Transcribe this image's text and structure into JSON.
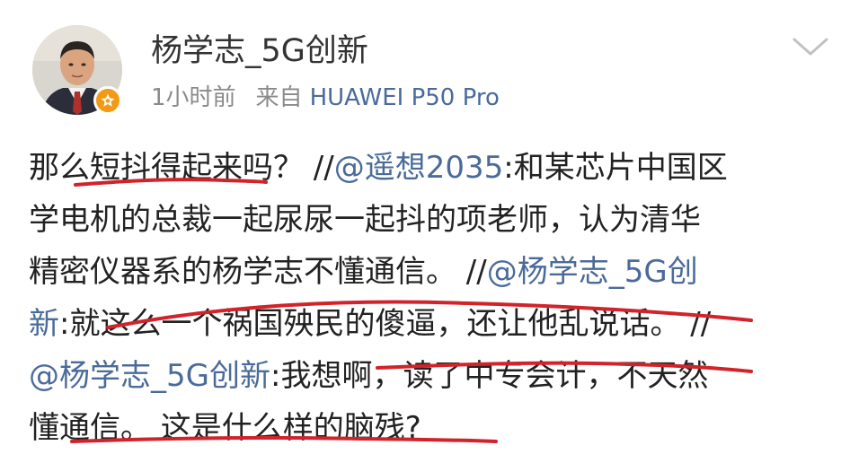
{
  "post": {
    "username": "杨学志_5G创新",
    "time": "1小时前",
    "source_prefix": "来自",
    "device": "HUAWEI P50 Pro",
    "avatar": "avatar-photo",
    "verified_badge": "star-badge-icon",
    "menu_icon": "chevron-down-icon",
    "body_lines": [
      [
        {
          "text": "那么短抖得起来吗？ //"
        },
        {
          "text": "@遥想2035",
          "mention": true
        },
        {
          "text": ":和某芯片中国区"
        }
      ],
      [
        {
          "text": "学电机的总裁一起尿尿一起抖的项老师，认为清华"
        }
      ],
      [
        {
          "text": "精密仪器系的杨学志不懂通信。 //"
        },
        {
          "text": "@杨学志_5G创",
          "mention": true
        }
      ],
      [
        {
          "text": "新",
          "mention": true
        },
        {
          "text": ":就这么一个祸国殃民的傻逼，还让他乱说话。 //"
        }
      ],
      [
        {
          "text": "@杨学志_5G创新",
          "mention": true
        },
        {
          "text": ":我想啊，读了中专会计，不天然"
        }
      ],
      [
        {
          "text": "懂通信。 这是什么样的脑残?"
        }
      ]
    ],
    "colors": {
      "username": "#333333",
      "meta": "#8a8a8a",
      "link": "#4a6b9a",
      "body": "#222222",
      "underline": "#d2232a",
      "badge": "#f29a16"
    }
  }
}
